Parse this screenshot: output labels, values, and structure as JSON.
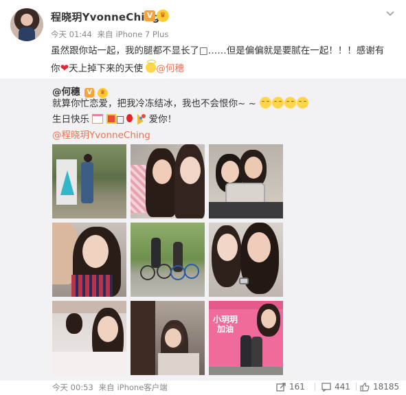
{
  "post": {
    "username": "程晓玥YvonneChing",
    "verified_badge": "V",
    "crown_badge": "♛",
    "time": "今天 01:44",
    "source_prefix": "来自",
    "source": "iPhone 7 Plus",
    "text_line1": "虽然跟你站一起，我的腿都不显长了□……但是偏偏就是要腻在一起！！！感谢有",
    "text_line2_a": "你",
    "text_line2_b": "天上掉下来的天使",
    "mention": "@何穗"
  },
  "repost": {
    "username": "@何穗",
    "verified_badge": "V",
    "crown_badge": "♛",
    "text_line1": "就算你忙恋爱，把我冷冻结冰，我也不会恨你~ ~",
    "text_line2_a": "生日快乐",
    "text_line2_b": "□",
    "text_line2_c": "爱你！",
    "mention": "@程晓玥YvonneChing",
    "photo9_sign_text": "小玥玥",
    "photo9_sign_text2": "加油"
  },
  "footer": {
    "time": "今天 00:53",
    "source_prefix": "来自",
    "source": "iPhone客户端",
    "repost_count": "161",
    "comment_count": "441",
    "like_count": "18185"
  },
  "colors": {
    "link": "#eb7350",
    "repost_bg": "#f2f2f5",
    "badge": "#f7a23b"
  }
}
